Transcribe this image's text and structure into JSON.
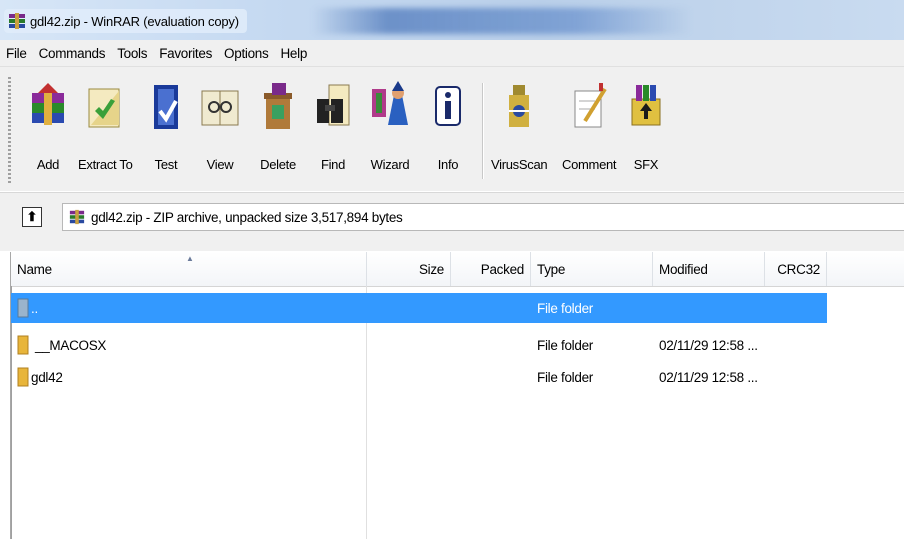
{
  "window": {
    "title": "gdl42.zip - WinRAR (evaluation copy)"
  },
  "menu": [
    "File",
    "Commands",
    "Tools",
    "Favorites",
    "Options",
    "Help"
  ],
  "toolbar": {
    "buttons": [
      {
        "label": "Add",
        "icon": "add-archive-icon"
      },
      {
        "label": "Extract To",
        "icon": "extract-to-icon"
      },
      {
        "label": "Test",
        "icon": "test-icon"
      },
      {
        "label": "View",
        "icon": "view-icon"
      },
      {
        "label": "Delete",
        "icon": "delete-icon"
      },
      {
        "label": "Find",
        "icon": "find-binoculars-icon"
      },
      {
        "label": "Wizard",
        "icon": "wizard-icon"
      },
      {
        "label": "Info",
        "icon": "info-icon"
      },
      {
        "label": "VirusScan",
        "icon": "virusscan-icon"
      },
      {
        "label": "Comment",
        "icon": "comment-icon"
      },
      {
        "label": "SFX",
        "icon": "sfx-icon"
      }
    ]
  },
  "address": {
    "text": "gdl42.zip - ZIP archive, unpacked size 3,517,894 bytes"
  },
  "columns": [
    "Name",
    "Size",
    "Packed",
    "Type",
    "Modified",
    "CRC32"
  ],
  "rows": [
    {
      "name": "..",
      "size": "",
      "packed": "",
      "type": "File folder",
      "modified": "",
      "crc": "",
      "selected": true
    },
    {
      "name": "__MACOSX",
      "size": "",
      "packed": "",
      "type": "File folder",
      "modified": "02/11/29 12:58 ...",
      "crc": "",
      "selected": false
    },
    {
      "name": "gdl42",
      "size": "",
      "packed": "",
      "type": "File folder",
      "modified": "02/11/29 12:58 ...",
      "crc": "",
      "selected": false
    }
  ],
  "colors": {
    "selection": "#3399ff",
    "folder": "#e8b53a"
  }
}
